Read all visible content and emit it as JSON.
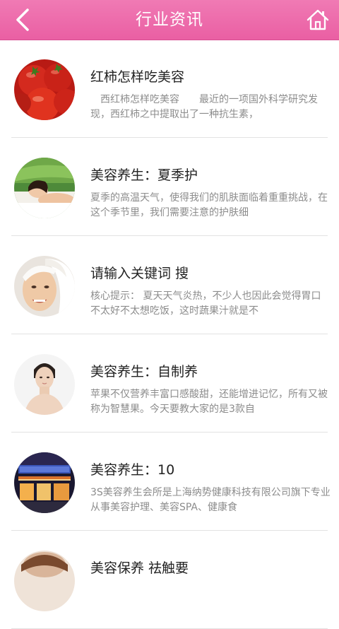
{
  "header": {
    "title": "行业资讯",
    "accent_color": "#ec6aaa"
  },
  "icons": {
    "back": "back-arrow-icon",
    "home": "home-icon"
  },
  "articles": [
    {
      "title": "红柿怎样吃美容",
      "summary": "　西红柿怎样吃美容　　最近的一项国外科学研究发现，西红柿之中提取出了一种抗生素，",
      "thumb": "tomatoes"
    },
    {
      "title": "美容养生：夏季护",
      "summary": "夏季的高温天气，使得我们的肌肤面临着重重挑战，在这个季节里，我们需要注意的护肤细",
      "thumb": "woman-spa"
    },
    {
      "title": "请输入关键词 搜",
      "summary": "核心提示：  夏天天气炎热，不少人也因此会觉得胃口不太好不太想吃饭，这时蔬果汁就是不",
      "thumb": "woman-towel"
    },
    {
      "title": "美容养生：自制养",
      "summary": "苹果不仅营养丰富口感酸甜，还能增进记忆，所有又被称为智慧果。今天要教大家的是3款自",
      "thumb": "woman-portrait"
    },
    {
      "title": "美容养生：10",
      "summary": "3S美容养生会所是上海纳势健康科技有限公司旗下专业从事美容护理、美容SPA、健康食",
      "thumb": "spa-storefront"
    },
    {
      "title": "美容保养 祛触要",
      "summary": "",
      "thumb": "woman-partial"
    }
  ]
}
